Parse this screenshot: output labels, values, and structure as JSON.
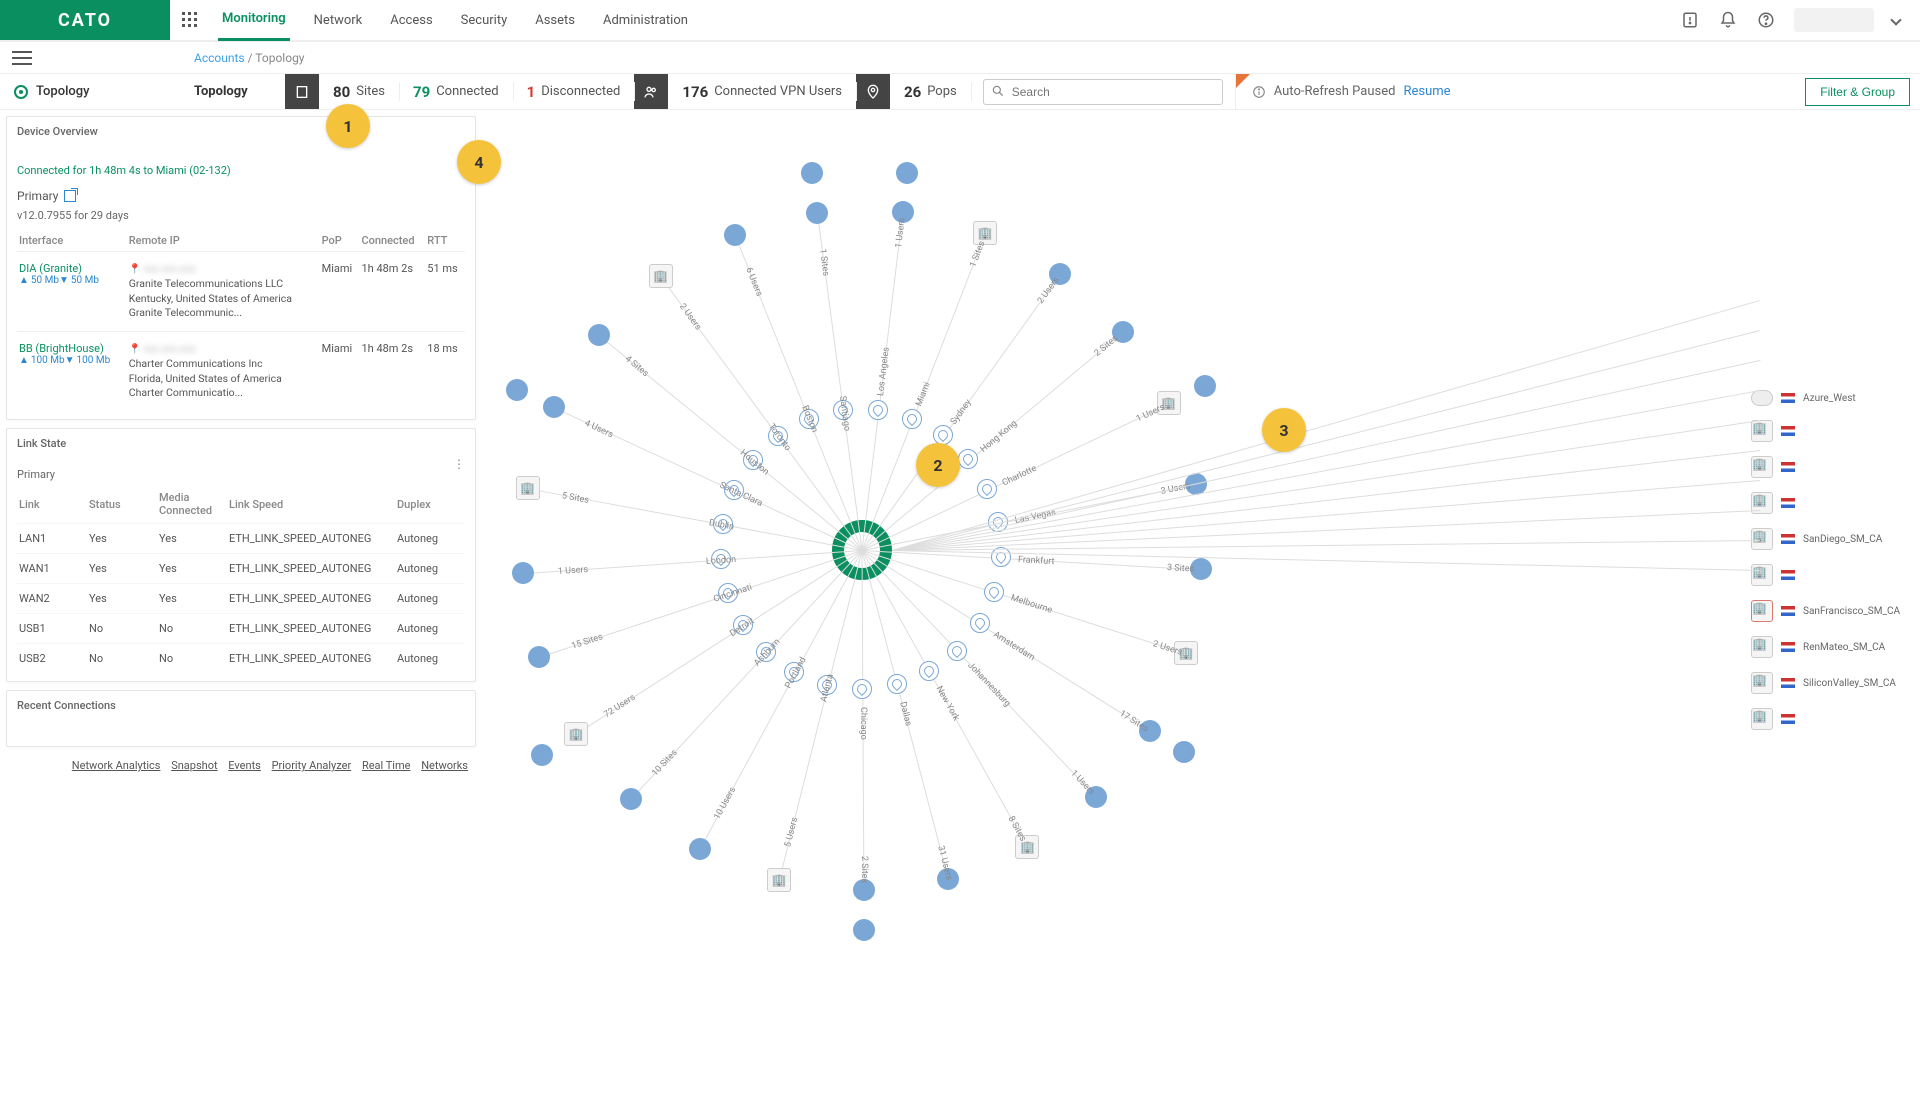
{
  "brand": "CATO",
  "nav": {
    "tabs": [
      "Monitoring",
      "Network",
      "Access",
      "Security",
      "Assets",
      "Administration"
    ],
    "activeIndex": 0
  },
  "breadcrumb": {
    "root": "Accounts",
    "sep": "/",
    "current": "Topology"
  },
  "leftNavItem": "Topology",
  "statsTitle": "Topology",
  "stats": {
    "sites": {
      "n": "80",
      "label": "Sites"
    },
    "connected": {
      "n": "79",
      "label": "Connected"
    },
    "disconnected": {
      "n": "1",
      "label": "Disconnected"
    },
    "vpn": {
      "n": "176",
      "label": "Connected VPN Users"
    },
    "pops": {
      "n": "26",
      "label": "Pops"
    }
  },
  "search": {
    "placeholder": "Search"
  },
  "autoRefresh": {
    "text": "Auto-Refresh Paused",
    "action": "Resume"
  },
  "filterBtn": "Filter & Group",
  "overview": {
    "title": "Device Overview",
    "connLine": "Connected for 1h 48m 4s to Miami (02-132)",
    "primary": "Primary",
    "version": "v12.0.7955 for 29 days",
    "cols": [
      "Interface",
      "Remote IP",
      "PoP",
      "Connected",
      "RTT"
    ],
    "rows": [
      {
        "ifname": "DIA (Granite)",
        "bwUp": "50 Mb",
        "bwDn": "50 Mb",
        "remote": "Granite Telecommunications LLC\nKentucky, United States of America\nGranite Telecommunic...",
        "pop": "Miami",
        "conn": "1h 48m 2s",
        "rtt": "51 ms"
      },
      {
        "ifname": "BB (BrightHouse)",
        "bwUp": "100 Mb",
        "bwDn": "100 Mb",
        "remote": "Charter Communications Inc\nFlorida, United States of America\nCharter Communicatio...",
        "pop": "Miami",
        "conn": "1h 48m 2s",
        "rtt": "18 ms"
      }
    ]
  },
  "linkState": {
    "title": "Link State",
    "sub": "Primary",
    "cols": [
      "Link",
      "Status",
      "Media Connected",
      "Link Speed",
      "Duplex"
    ],
    "rows": [
      {
        "l": "LAN1",
        "s": "Yes",
        "m": "Yes",
        "sp": "ETH_LINK_SPEED_AUTONEG",
        "d": "Autoneg"
      },
      {
        "l": "WAN1",
        "s": "Yes",
        "m": "Yes",
        "sp": "ETH_LINK_SPEED_AUTONEG",
        "d": "Autoneg"
      },
      {
        "l": "WAN2",
        "s": "Yes",
        "m": "Yes",
        "sp": "ETH_LINK_SPEED_AUTONEG",
        "d": "Autoneg"
      },
      {
        "l": "USB1",
        "s": "No",
        "m": "No",
        "sp": "ETH_LINK_SPEED_AUTONEG",
        "d": "Autoneg"
      },
      {
        "l": "USB2",
        "s": "No",
        "m": "No",
        "sp": "ETH_LINK_SPEED_AUTONEG",
        "d": "Autoneg"
      }
    ]
  },
  "recent": {
    "title": "Recent Connections"
  },
  "footerLinks": [
    "Network Analytics",
    "Snapshot",
    "Events",
    "Priority Analyzer",
    "Real Time",
    "Networks"
  ],
  "popLabels": [
    "Los Angeles",
    "Miami",
    "Sydney",
    "Hong Kong",
    "Charlotte",
    "Las Vegas",
    "Frankfurt",
    "Melbourne",
    "Amsterdam",
    "Johannesburg",
    "New York",
    "Dallas",
    "Chicago",
    "Atlanta",
    "Portland",
    "Ashburn",
    "Detroit",
    "Cincinnati",
    "London",
    "Dublin",
    "Santa Clara",
    "Houston",
    "Toronto",
    "Boston",
    "Santiago"
  ],
  "outerLabels": {
    "users1": "1 Users",
    "users2": "2 Users",
    "users3": "3 Users",
    "users4": "4 Users",
    "users5": "5 Users",
    "users6": "6 Users",
    "users10": "10 Users",
    "users31": "31 Users",
    "users72": "72 Users",
    "sites1": "1 Sites",
    "sites2": "2 Sites",
    "sites3": "3 Sites",
    "sites4": "4 Sites",
    "sites5": "5 Sites",
    "sites8": "8 Sites",
    "sites10": "10 Sites",
    "sites15": "15 Sites",
    "sites17": "17 Sites"
  },
  "east": [
    {
      "icon": "cloud",
      "label": "Azure_West"
    },
    {
      "icon": "site",
      "label": ""
    },
    {
      "icon": "site",
      "label": ""
    },
    {
      "icon": "site",
      "label": ""
    },
    {
      "icon": "site",
      "label": "SanDiego_SM_CA"
    },
    {
      "icon": "site",
      "label": ""
    },
    {
      "icon": "site-red",
      "label": "SanFrancisco_SM_CA"
    },
    {
      "icon": "site",
      "label": "RenMateo_SM_CA"
    },
    {
      "icon": "site",
      "label": "SiliconValley_SM_CA"
    },
    {
      "icon": "site",
      "label": ""
    }
  ],
  "annotations": {
    "a1": "1",
    "a2": "2",
    "a3": "3",
    "a4": "4"
  }
}
